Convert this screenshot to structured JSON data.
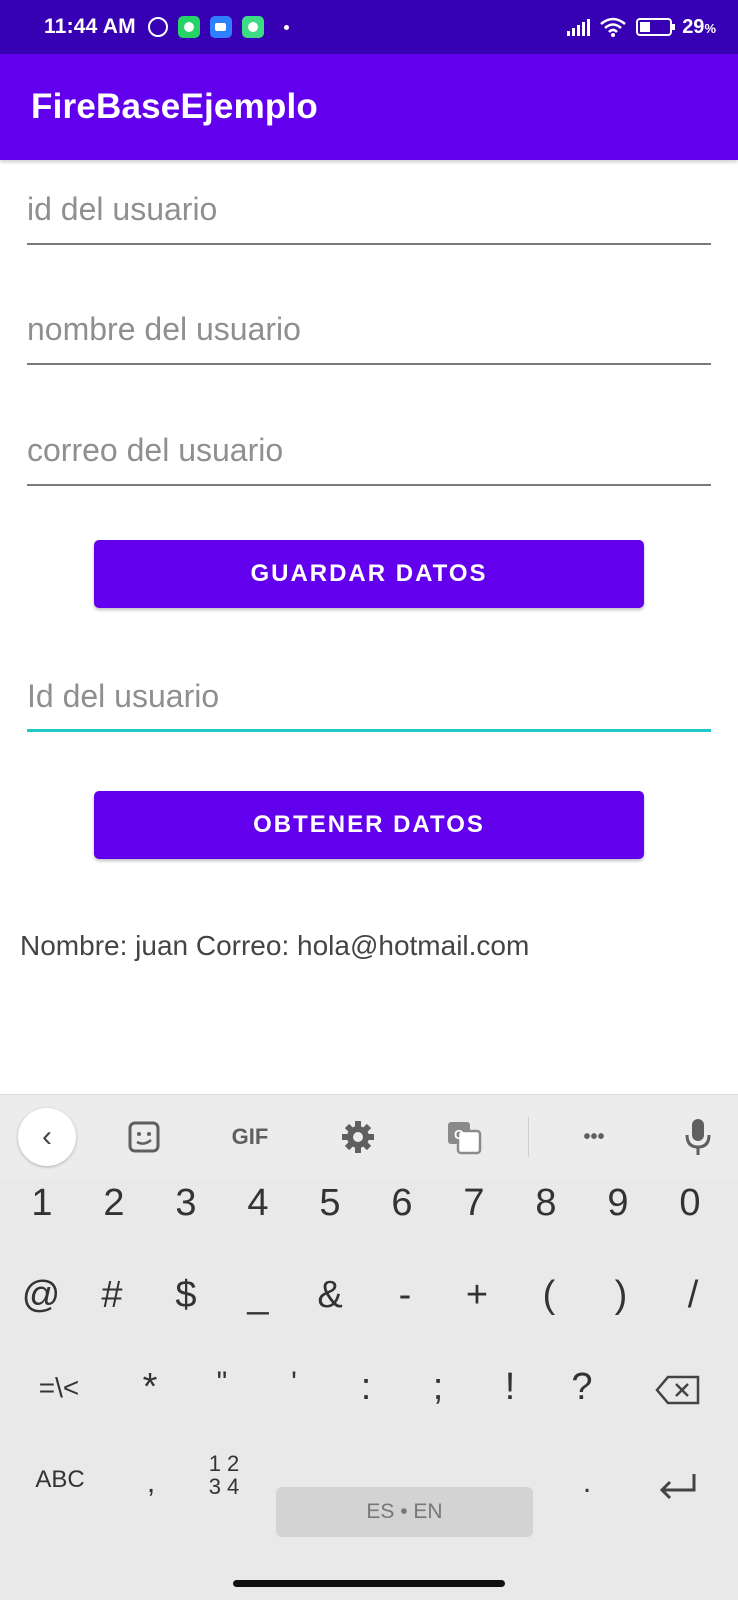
{
  "status_bar": {
    "time": "11:44 AM",
    "battery_percent": "29",
    "battery_unit": "%"
  },
  "app_bar": {
    "title": "FireBaseEjemplo"
  },
  "form": {
    "id_placeholder": "id del usuario",
    "name_placeholder": "nombre del usuario",
    "email_placeholder": "correo del usuario",
    "save_button": "GUARDAR DATOS",
    "lookup_placeholder": "Id del usuario",
    "get_button": "OBTENER DATOS"
  },
  "result_text": "Nombre:  juan Correo: hola@hotmail.com",
  "keyboard": {
    "toolbar": {
      "gif_label": "GIF",
      "more_label": "•••",
      "back_glyph": "‹"
    },
    "digits": [
      "1",
      "2",
      "3",
      "4",
      "5",
      "6",
      "7",
      "8",
      "9",
      "0"
    ],
    "symbols_row1": [
      "@",
      "#",
      "$",
      "_",
      "&",
      "-",
      "+",
      "(",
      ")",
      "/"
    ],
    "symbols_row2": [
      "=\\<",
      "*",
      "\"",
      "'",
      ":",
      ";",
      "!",
      "?"
    ],
    "bottom": {
      "abc": "ABC",
      "comma": ",",
      "num_top": "1 2",
      "num_bottom": "3 4",
      "space": "ES • EN",
      "period": "."
    }
  },
  "colors": {
    "status_bar": "#3700B3",
    "primary": "#6200EE",
    "focus_underline": "#1fc9c4"
  }
}
